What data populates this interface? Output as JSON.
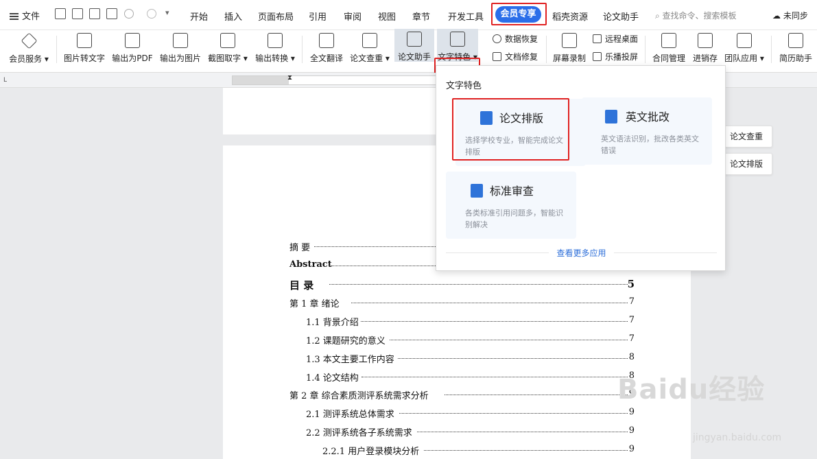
{
  "menubar": {
    "file": "文件",
    "tabs": [
      "开始",
      "插入",
      "页面布局",
      "引用",
      "审阅",
      "视图",
      "章节",
      "开发工具"
    ],
    "active_tab": "会员专享",
    "tabs_after": [
      "稻壳资源",
      "论文助手"
    ],
    "search_placeholder": "查找命令、搜索模板",
    "sync": "未同步"
  },
  "ribbon": {
    "member_service": "会员服务",
    "img_to_text": "图片转文字",
    "export_pdf": "输出为PDF",
    "export_img": "输出为图片",
    "screenshot_text": "截图取字",
    "export_convert": "输出转换",
    "translate": "全文翻译",
    "plagiarism": "论文查重",
    "paper_assistant": "论文助手",
    "text_feature": "文字特色",
    "data_recovery": "数据恢复",
    "doc_repair": "文档修复",
    "screen_record": "屏幕录制",
    "remote_desktop": "远程桌面",
    "cast": "乐播投屏",
    "contract": "合同管理",
    "inventory": "进销存",
    "team_apps": "团队应用",
    "resume": "简历助手"
  },
  "dropdown": {
    "title": "文字特色",
    "cards": [
      {
        "title": "论文排版",
        "desc": "选择学校专业，智能完成论文排版"
      },
      {
        "title": "英文批改",
        "desc": "英文语法识别，批改各类英文错误"
      },
      {
        "title": "标准审查",
        "desc": "各类标准引用问题多，智能识别解决"
      }
    ],
    "more": "查看更多应用"
  },
  "side_buttons": {
    "check": "论文查重",
    "format": "论文排版"
  },
  "toc": [
    {
      "text": "摘 要",
      "page": ""
    },
    {
      "text": "Abstract",
      "page": ""
    },
    {
      "text": "目    录",
      "page": "5"
    },
    {
      "text": "第 1 章    绪论",
      "page": "7"
    },
    {
      "text": "1.1 背景介绍",
      "page": "7"
    },
    {
      "text": "1.2 课题研究的意义",
      "page": "7"
    },
    {
      "text": "1.3 本文主要工作内容",
      "page": "8"
    },
    {
      "text": "1.4 论文结构",
      "page": "8"
    },
    {
      "text": "第 2 章    综合素质测评系统需求分析",
      "page": "9"
    },
    {
      "text": "2.1 测评系统总体需求",
      "page": "9"
    },
    {
      "text": "2.2 测评系统各子系统需求",
      "page": "9"
    },
    {
      "text": "2.2.1 用户登录模块分析",
      "page": "9"
    }
  ],
  "watermark": {
    "logo": "Baidu经验",
    "url": "jingyan.baidu.com"
  },
  "colors": {
    "accent": "#2b6ee9",
    "highlight": "#e02020"
  }
}
